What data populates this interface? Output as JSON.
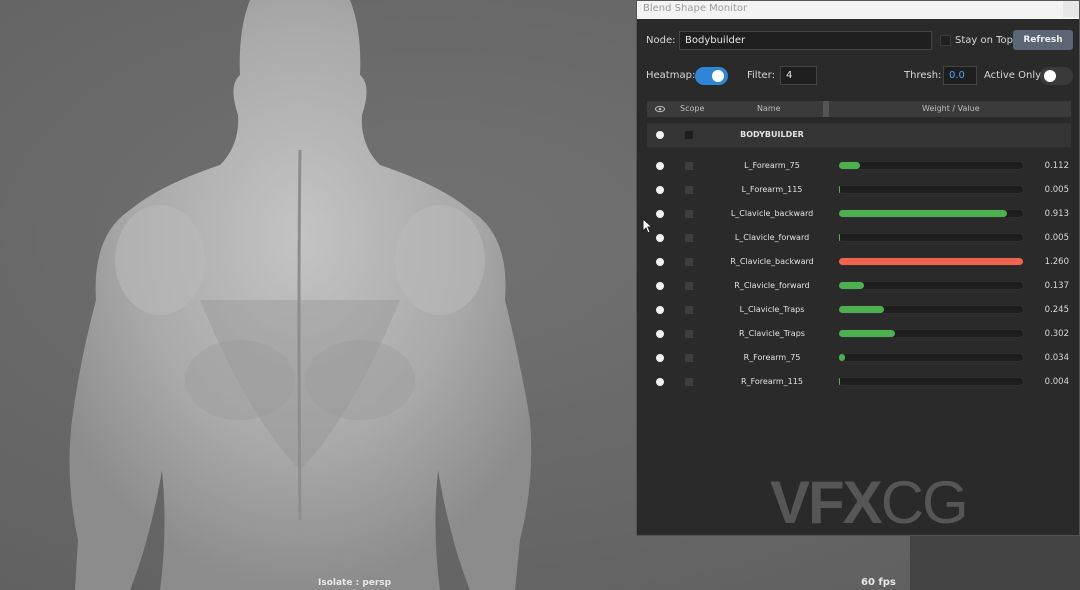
{
  "viewport": {
    "hud_camera": "Isolate : persp",
    "hud_fps": "60 fps"
  },
  "window": {
    "title": "Blend Shape Monitor",
    "node_label": "Node:",
    "node_value": "Bodybuilder",
    "stay_on_top_label": "Stay on Top",
    "stay_on_top_checked": false,
    "refresh_label": "Refresh",
    "heatmap_label": "Heatmap:",
    "heatmap_on": true,
    "filter_label": "Filter:",
    "filter_value": "4",
    "thresh_label": "Thresh:",
    "thresh_value": "0.0",
    "active_only_label": "Active Only",
    "active_only_on": false
  },
  "table": {
    "headers": {
      "visibility_icon": "eye-icon",
      "scope": "Scope",
      "name": "Name",
      "weight": "Weight / Value"
    },
    "group": "BODYBUILDER",
    "rows": [
      {
        "name": "L_Forearm_75",
        "value": "0.112",
        "weight": 0.112,
        "color": "#4caf50"
      },
      {
        "name": "L_Forearm_115",
        "value": "0.005",
        "weight": 0.005,
        "color": "#4caf50"
      },
      {
        "name": "L_Clavicle_backward",
        "value": "0.913",
        "weight": 0.913,
        "color": "#4caf50"
      },
      {
        "name": "L_Clavicle_forward",
        "value": "0.005",
        "weight": 0.005,
        "color": "#4caf50"
      },
      {
        "name": "R_Clavicle_backward",
        "value": "1.260",
        "weight": 1.0,
        "color": "#f0634f"
      },
      {
        "name": "R_Clavicle_forward",
        "value": "0.137",
        "weight": 0.137,
        "color": "#4caf50"
      },
      {
        "name": "L_Clavicle_Traps",
        "value": "0.245",
        "weight": 0.245,
        "color": "#4caf50"
      },
      {
        "name": "R_Clavicle_Traps",
        "value": "0.302",
        "weight": 0.302,
        "color": "#4caf50"
      },
      {
        "name": "R_Forearm_75",
        "value": "0.034",
        "weight": 0.034,
        "color": "#4caf50"
      },
      {
        "name": "R_Forearm_115",
        "value": "0.004",
        "weight": 0.004,
        "color": "#4caf50"
      }
    ]
  },
  "watermark": {
    "bold": "VFX",
    "light": "CG"
  }
}
